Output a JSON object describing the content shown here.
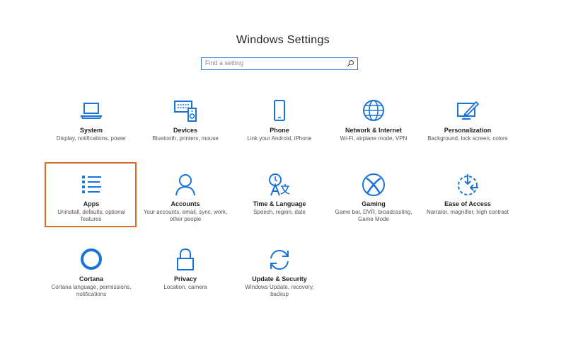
{
  "window": {
    "title": "Windows Settings"
  },
  "search": {
    "placeholder": "Find a setting"
  },
  "tiles": [
    {
      "label": "System",
      "desc": "Display, notifications, power",
      "icon": "laptop-icon"
    },
    {
      "label": "Devices",
      "desc": "Bluetooth, printers, mouse",
      "icon": "devices-icon"
    },
    {
      "label": "Phone",
      "desc": "Link your Android, iPhone",
      "icon": "phone-icon"
    },
    {
      "label": "Network & Internet",
      "desc": "Wi-Fi, airplane mode, VPN",
      "icon": "globe-icon"
    },
    {
      "label": "Personalization",
      "desc": "Background, lock screen, colors",
      "icon": "paint-icon"
    },
    {
      "label": "Apps",
      "desc": "Uninstall, defaults, optional features",
      "icon": "apps-list-icon"
    },
    {
      "label": "Accounts",
      "desc": "Your accounts, email, sync, work, other people",
      "icon": "person-icon"
    },
    {
      "label": "Time & Language",
      "desc": "Speech, region, date",
      "icon": "time-language-icon"
    },
    {
      "label": "Gaming",
      "desc": "Game bar, DVR, broadcasting, Game Mode",
      "icon": "xbox-icon"
    },
    {
      "label": "Ease of Access",
      "desc": "Narrator, magnifier, high contrast",
      "icon": "ease-of-access-icon"
    },
    {
      "label": "Cortana",
      "desc": "Cortana language, permissions, notifications",
      "icon": "cortana-icon"
    },
    {
      "label": "Privacy",
      "desc": "Location, camera",
      "icon": "lock-icon"
    },
    {
      "label": "Update & Security",
      "desc": "Windows Update, recovery, backup",
      "icon": "sync-icon"
    }
  ],
  "colors": {
    "accent": "#1a73d9",
    "selection": "#d96b2b"
  }
}
